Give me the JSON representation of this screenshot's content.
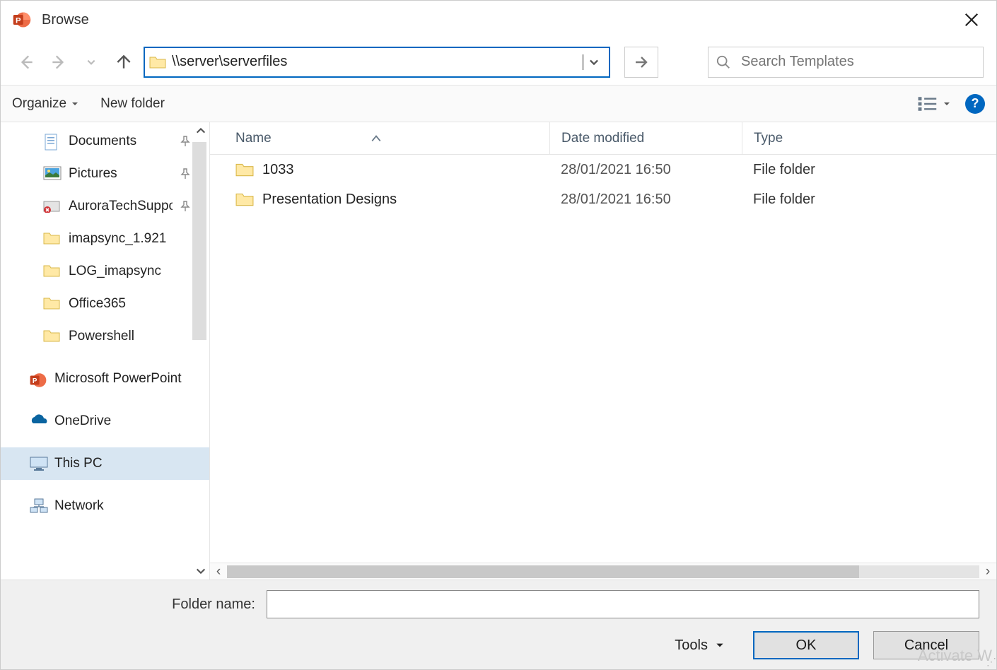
{
  "title": "Browse",
  "address_path": "\\\\server\\serverfiles",
  "search_placeholder": "Search Templates",
  "toolbar": {
    "organize": "Organize",
    "new_folder": "New folder"
  },
  "sidebar": {
    "items": [
      {
        "label": "Documents",
        "icon": "document",
        "pinned": true
      },
      {
        "label": "Pictures",
        "icon": "pictures",
        "pinned": true
      },
      {
        "label": "AuroraTechSupport",
        "icon": "sync-err",
        "pinned": true
      },
      {
        "label": "imapsync_1.921",
        "icon": "folder",
        "pinned": false
      },
      {
        "label": "LOG_imapsync",
        "icon": "folder",
        "pinned": false
      },
      {
        "label": "Office365",
        "icon": "folder",
        "pinned": false
      },
      {
        "label": "Powershell",
        "icon": "folder",
        "pinned": false
      },
      {
        "label": "Microsoft PowerPoint",
        "icon": "ppt",
        "pinned": false
      },
      {
        "label": "OneDrive",
        "icon": "onedrive",
        "pinned": false
      },
      {
        "label": "This PC",
        "icon": "thispc",
        "pinned": false,
        "selected": true
      },
      {
        "label": "Network",
        "icon": "network",
        "pinned": false
      }
    ]
  },
  "columns": {
    "name": "Name",
    "date": "Date modified",
    "type": "Type"
  },
  "files": [
    {
      "name": "1033",
      "date": "28/01/2021 16:50",
      "type": "File folder"
    },
    {
      "name": "Presentation Designs",
      "date": "28/01/2021 16:50",
      "type": "File folder"
    }
  ],
  "footer": {
    "folder_name_label": "Folder name:",
    "folder_name_value": "",
    "tools": "Tools",
    "ok": "OK",
    "cancel": "Cancel"
  },
  "watermark": "Activate W"
}
